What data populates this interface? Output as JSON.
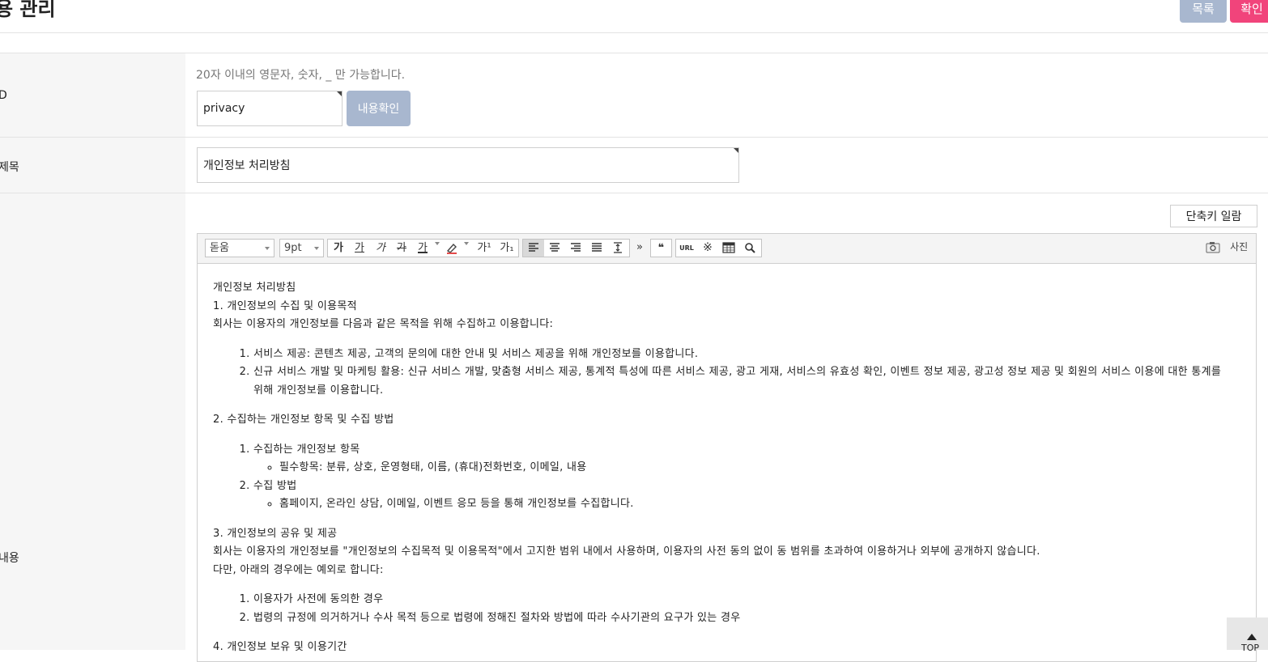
{
  "header": {
    "title": "용 관리",
    "list_button": "목록",
    "confirm_button": "확인"
  },
  "form": {
    "id_row": {
      "label": "D",
      "hint": "20자 이내의 영문자, 숫자, _ 만 가능합니다.",
      "value": "privacy",
      "check_button": "내용확인"
    },
    "title_row": {
      "label": "제목",
      "value": "개인정보 처리방침"
    },
    "content_row": {
      "label": "내용",
      "shortcut_button": "단축키 일람"
    }
  },
  "editor": {
    "font_select": "돋움",
    "size_select": "9pt",
    "format_buttons": [
      "가",
      "가",
      "가",
      "가",
      "가"
    ],
    "superscript": "가¹",
    "subscript": "가₁",
    "more_icon": "»",
    "quote_icon": "❝",
    "url_label": "URL",
    "special_char_icon": "※",
    "photo_label": "사진",
    "content": {
      "heading": "개인정보 처리방침",
      "s1_title": "1. 개인정보의 수집 및 이용목적",
      "s1_intro": "회사는 이용자의 개인정보를 다음과 같은 목적을 위해 수집하고 이용합니다:",
      "s1_items": [
        "서비스 제공: 콘텐츠 제공, 고객의 문의에 대한 안내 및 서비스 제공을 위해 개인정보를 이용합니다.",
        "신규 서비스 개발 및 마케팅 활용: 신규 서비스 개발, 맞춤형 서비스 제공, 통계적 특성에 따른 서비스 제공, 광고 게재, 서비스의 유효성 확인, 이벤트 정보 제공, 광고성 정보 제공 및 회원의 서비스 이용에 대한 통계를 위해 개인정보를 이용합니다."
      ],
      "s2_title": "2. 수집하는 개인정보 항목 및 수집 방법",
      "s2_item1": "수집하는 개인정보 항목",
      "s2_item1_sub": "필수항목: 분류, 상호, 운영형태, 이름, (휴대)전화번호, 이메일, 내용",
      "s2_item2": "수집 방법",
      "s2_item2_sub": "홈페이지, 온라인 상담, 이메일, 이벤트 응모 등을 통해 개인정보를 수집합니다.",
      "s3_title": "3. 개인정보의 공유 및 제공",
      "s3_intro_1": "회사는 이용자의 개인정보를 \"개인정보의 수집목적 및 이용목적\"에서 고지한 범위 내에서 사용하며, 이용자의 사전 동의 없이 동 범위를 초과하여 이용하거나 외부에 공개하지 않습니다.",
      "s3_intro_2": "다만, 아래의 경우에는 예외로 합니다:",
      "s3_items": [
        "이용자가 사전에 동의한 경우",
        "법령의 규정에 의거하거나 수사 목적 등으로 법령에 정해진 절차와 방법에 따라 수사기관의 요구가 있는 경우"
      ],
      "s4_title": "4. 개인정보 보유 및 이용기간"
    }
  },
  "scroll_top": {
    "label": "TOP"
  }
}
